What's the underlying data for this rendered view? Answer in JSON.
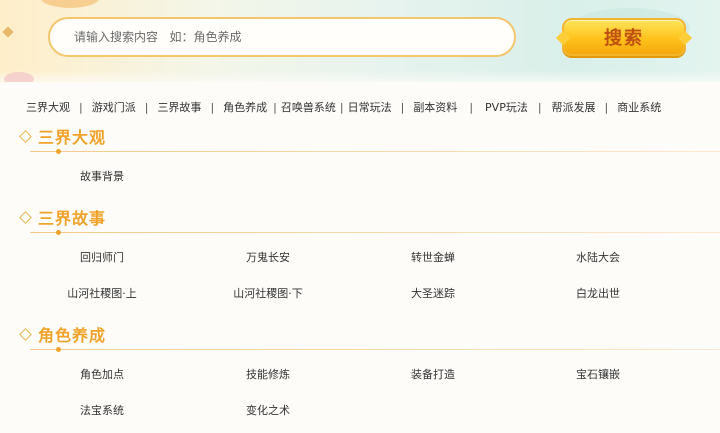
{
  "search": {
    "placeholder": "请输入搜索内容   如：角色养成",
    "button_label": "搜索"
  },
  "nav": {
    "items": [
      "三界大观",
      "游戏门派",
      "三界故事",
      "角色养成",
      "召唤兽系统",
      "日常玩法",
      "副本资料",
      "PVP玩法",
      "帮派发展",
      "商业系统"
    ],
    "separator": "|"
  },
  "sections": [
    {
      "title": "三界大观",
      "links": [
        "故事背景"
      ]
    },
    {
      "title": "三界故事",
      "links": [
        "回归师门",
        "万鬼长安",
        "转世金蝉",
        "水陆大会",
        "山河社稷图·上",
        "山河社稷图·下",
        "大圣迷踪",
        "白龙出世"
      ]
    },
    {
      "title": "角色养成",
      "links": [
        "角色加点",
        "技能修炼",
        "装备打造",
        "宝石镶嵌",
        "法宝系统",
        "变化之术"
      ]
    }
  ]
}
